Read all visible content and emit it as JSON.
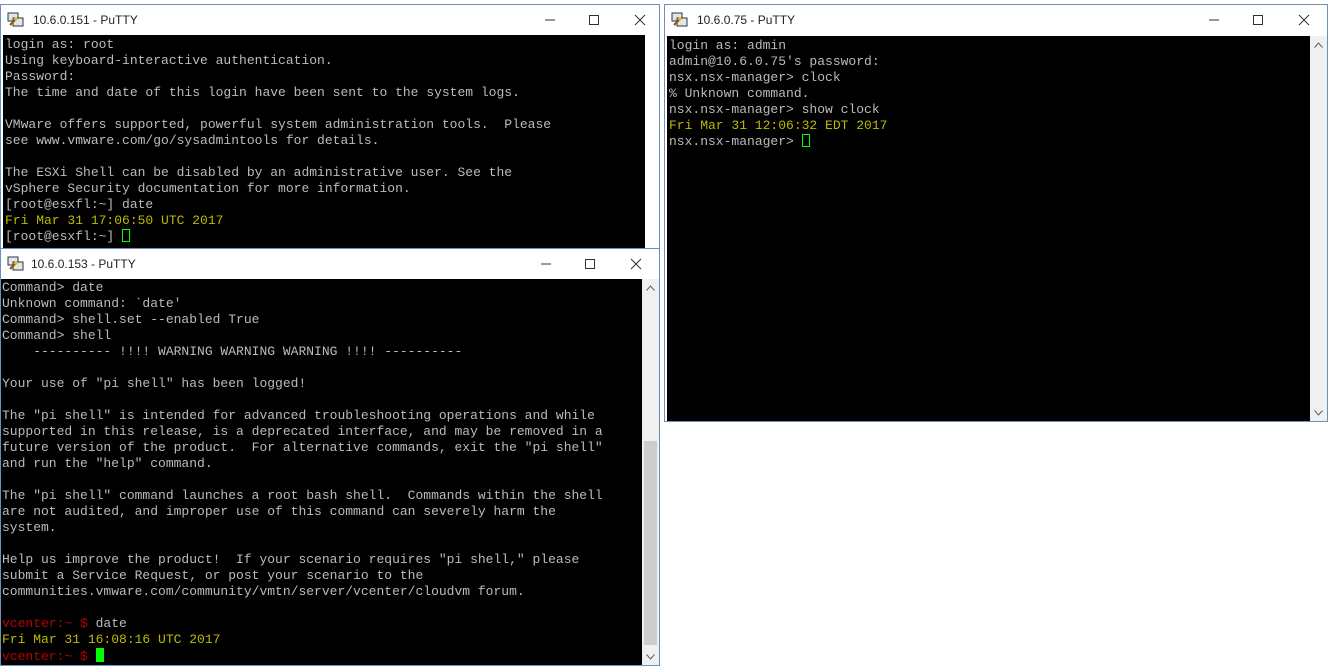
{
  "windows": {
    "w151": {
      "title": "10.6.0.151 - PuTTY",
      "lines": [
        "login as: root",
        "Using keyboard-interactive authentication.",
        "Password:",
        "The time and date of this login have been sent to the system logs.",
        "",
        "VMware offers supported, powerful system administration tools.  Please",
        "see www.vmware.com/go/sysadmintools for details.",
        "",
        "The ESXi Shell can be disabled by an administrative user. See the",
        "vSphere Security documentation for more information.",
        "[root@esxfl:~] date"
      ],
      "date_output": "Fri Mar 31 17:06:50 UTC 2017",
      "prompt": "[root@esxfl:~] "
    },
    "w75": {
      "title": "10.6.0.75 - PuTTY",
      "lines": [
        "login as: admin",
        "admin@10.6.0.75's password:",
        "nsx.nsx-manager> clock",
        "% Unknown command.",
        "nsx.nsx-manager> show clock"
      ],
      "date_output": "Fri Mar 31 12:06:32 EDT 2017",
      "prompt": "nsx.nsx-manager> "
    },
    "w153": {
      "title": "10.6.0.153 - PuTTY",
      "lines": [
        "Command> date",
        "Unknown command: `date'",
        "Command> shell.set --enabled True",
        "Command> shell",
        "    ---------- !!!! WARNING WARNING WARNING !!!! ----------",
        "",
        "Your use of \"pi shell\" has been logged!",
        "",
        "The \"pi shell\" is intended for advanced troubleshooting operations and while",
        "supported in this release, is a deprecated interface, and may be removed in a",
        "future version of the product.  For alternative commands, exit the \"pi shell\"",
        "and run the \"help\" command.",
        "",
        "The \"pi shell\" command launches a root bash shell.  Commands within the shell",
        "are not audited, and improper use of this command can severely harm the",
        "system.",
        "",
        "Help us improve the product!  If your scenario requires \"pi shell,\" please",
        "submit a Service Request, or post your scenario to the",
        "communities.vmware.com/community/vmtn/server/vcenter/cloudvm forum.",
        ""
      ],
      "prompt_red": "vcenter:~ $",
      "command": " date",
      "date_output": "Fri Mar 31 16:08:16 UTC 2017",
      "prompt_red_2": "vcenter:~ $"
    }
  },
  "colors": {
    "terminal_bg": "#000000",
    "terminal_fg": "#bbbbbb",
    "yellow": "#bbbb00",
    "red": "#bb0000",
    "cursor": "#00ff00"
  },
  "icons": {
    "app": "putty-icon",
    "minimize": "minimize-icon",
    "maximize": "maximize-icon",
    "close": "close-icon"
  }
}
